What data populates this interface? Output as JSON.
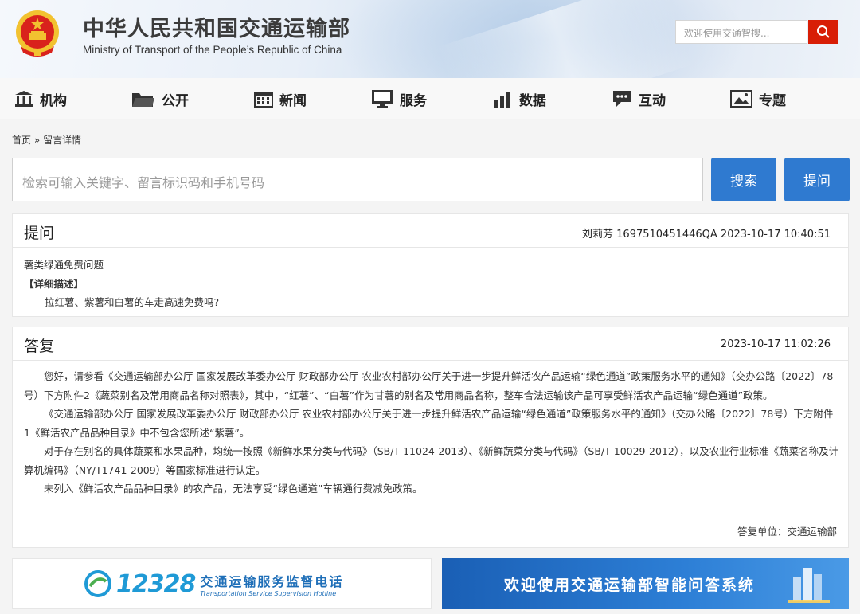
{
  "header": {
    "title": "中华人民共和国交通运输部",
    "subtitle": "Ministry of Transport of the People’s Republic of China",
    "search_placeholder": "欢迎使用交通智搜..."
  },
  "nav": {
    "items": [
      {
        "label": "机构",
        "icon": "institution-icon"
      },
      {
        "label": "公开",
        "icon": "folder-icon"
      },
      {
        "label": "新闻",
        "icon": "calendar-icon"
      },
      {
        "label": "服务",
        "icon": "monitor-icon"
      },
      {
        "label": "数据",
        "icon": "bar-chart-icon"
      },
      {
        "label": "互动",
        "icon": "chat-icon"
      },
      {
        "label": "专题",
        "icon": "image-icon"
      }
    ]
  },
  "breadcrumb": {
    "home": "首页",
    "separator": "»",
    "current": "留言详情"
  },
  "search": {
    "placeholder": "检索可输入关键字、留言标识码和手机号码",
    "search_label": "搜索",
    "ask_label": "提问"
  },
  "question": {
    "heading": "提问",
    "meta": "刘莉芳 1697510451446QA 2023-10-17 10:40:51",
    "subject": "薯类绿通免费问题",
    "detail_label": "【详细描述】",
    "detail": "拉红薯、紫薯和白薯的车走高速免费吗?"
  },
  "answer": {
    "heading": "答复",
    "time": "2023-10-17 11:02:26",
    "paragraphs": [
      "您好，请参看《交通运输部办公厅 国家发展改革委办公厅 财政部办公厅 农业农村部办公厅关于进一步提升鲜活农产品运输“绿色通道”政策服务水平的通知》（交办公路〔2022〕78号）下方附件2《蔬菜别名及常用商品名称对照表》，其中，“红薯”、“白薯”作为甘薯的别名及常用商品名称，整车合法运输该产品可享受鲜活农产品运输“绿色通道”政策。",
      "《交通运输部办公厅 国家发展改革委办公厅 财政部办公厅 农业农村部办公厅关于进一步提升鲜活农产品运输“绿色通道”政策服务水平的通知》（交办公路〔2022〕78号）下方附件1《鲜活农产品品种目录》中不包含您所述“紫薯”。",
      "对于存在别名的具体蔬菜和水果品种，均统一按照《新鲜水果分类与代码》（SB/T 11024-2013）、《新鲜蔬菜分类与代码》（SB/T 10029-2012），以及农业行业标准《蔬菜名称及计算机编码》（NY/T1741-2009）等国家标准进行认定。",
      "未列入《鲜活农产品品种目录》的农产品，无法享受“绿色通道”车辆通行费减免政策。"
    ],
    "unit": "答复单位：交通运输部"
  },
  "banners": {
    "hotline_number": "12328",
    "hotline_cn": "交通运输服务监督电话",
    "hotline_en": "Transportation Service Supervision Hotline",
    "qa_system": "欢迎使用交通运输部智能问答系统"
  },
  "colors": {
    "accent_blue": "#2f7ad0",
    "search_red": "#d81e06",
    "emblem_red": "#d9221c",
    "emblem_gold": "#f2c230"
  }
}
